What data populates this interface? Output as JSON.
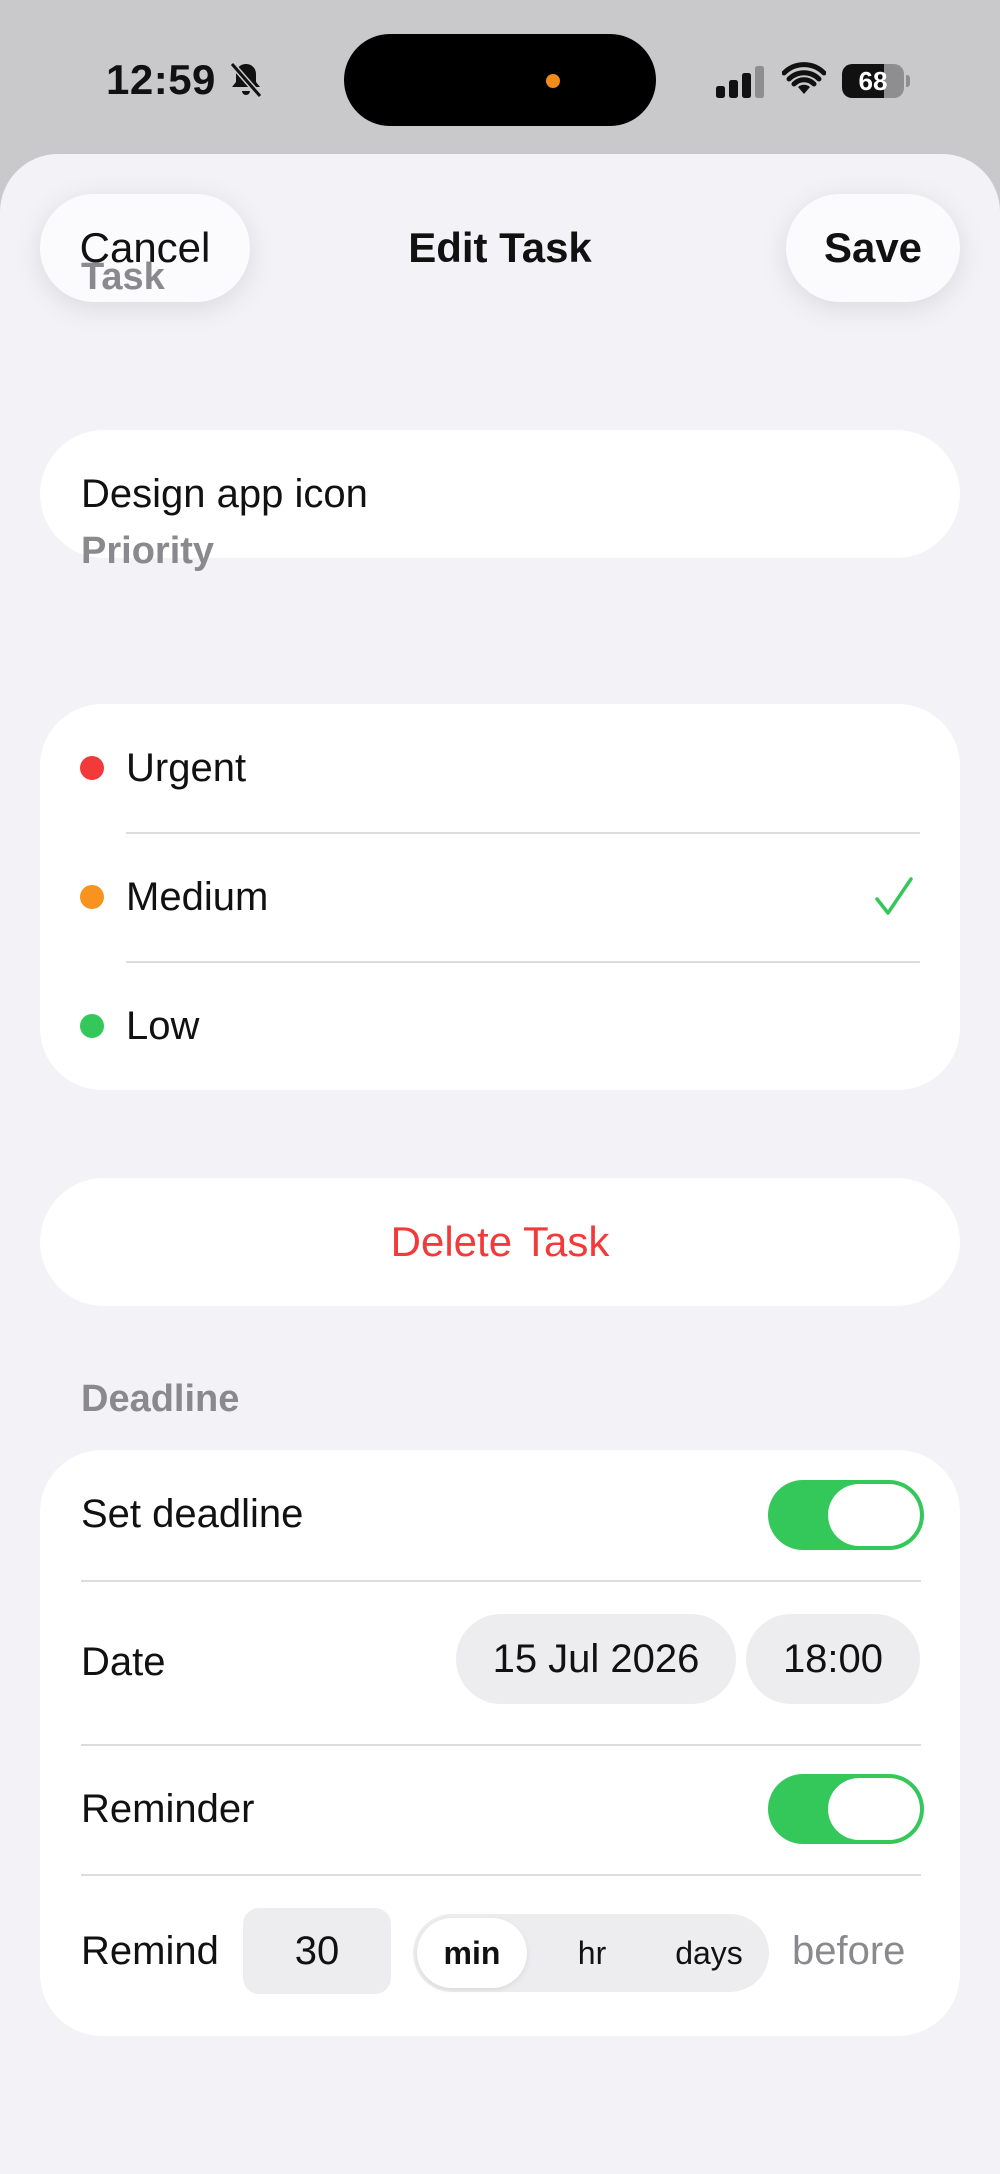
{
  "status_bar": {
    "time": "12:59",
    "battery": "68",
    "battery_level": 0.68,
    "icons": [
      "bell-slash-icon",
      "cellular-signal-icon",
      "wifi-icon",
      "battery-icon"
    ]
  },
  "nav": {
    "cancel_label": "Cancel",
    "title": "Edit Task",
    "save_label": "Save"
  },
  "task": {
    "label": "Task",
    "value": "Design app icon"
  },
  "priority": {
    "label": "Priority",
    "items": [
      {
        "label": "Urgent",
        "color": "#f23a3a",
        "selected": false
      },
      {
        "label": "Medium",
        "color": "#f7931e",
        "selected": true
      },
      {
        "label": "Low",
        "color": "#34c759",
        "selected": false
      }
    ],
    "check_color": "#34c759"
  },
  "delete": {
    "label": "Delete Task",
    "color": "#f23a3a"
  },
  "deadline": {
    "label": "Deadline",
    "set_deadline_label": "Set deadline",
    "set_deadline_on": true,
    "date_label": "Date",
    "date_value": "15 Jul 2026",
    "time_value": "18:00",
    "reminder_label": "Reminder",
    "reminder_on": true,
    "remind_label": "Remind",
    "remind_amount": "30",
    "units": [
      "min",
      "hr",
      "days"
    ],
    "selected_unit": "min",
    "before_label": "before",
    "toggle_color": "#34c759"
  }
}
